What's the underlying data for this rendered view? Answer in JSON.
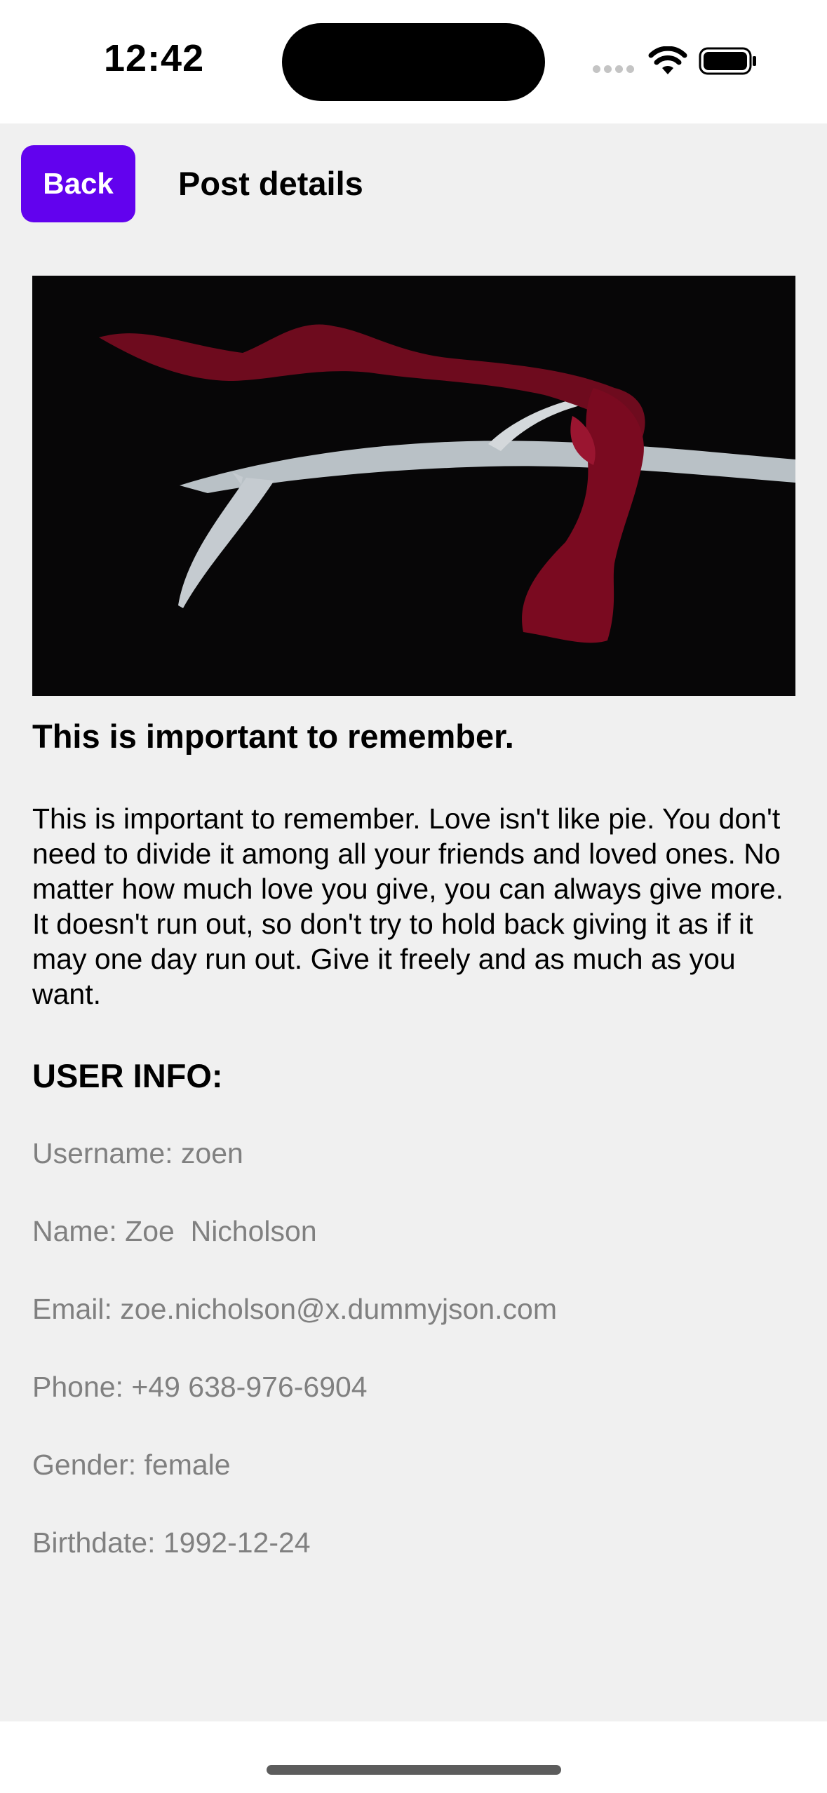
{
  "status_bar": {
    "time": "12:42"
  },
  "header": {
    "back_label": "Back",
    "title": "Post details"
  },
  "post": {
    "image_icon": "antler-with-red-ribbon-photo",
    "title": "This is important to remember.",
    "body": "This is important to remember. Love isn't like pie. You don't need to divide it among all your friends and loved ones. No matter how much love you give, you can always give more. It doesn't run out, so don't try to hold back giving it as if it may one day run out. Give it freely and as much as you want."
  },
  "user_info": {
    "heading": "USER INFO:",
    "username": "Username: zoen",
    "name": "Name: Zoe  Nicholson",
    "email": "Email: zoe.nicholson@x.dummyjson.com",
    "phone": "Phone: +49 638-976-6904",
    "gender": "Gender: female",
    "birthdate": "Birthdate: 1992-12-24"
  },
  "colors": {
    "accent": "#6202ee",
    "background": "#f0f0f0",
    "secondary_text": "#808080"
  }
}
